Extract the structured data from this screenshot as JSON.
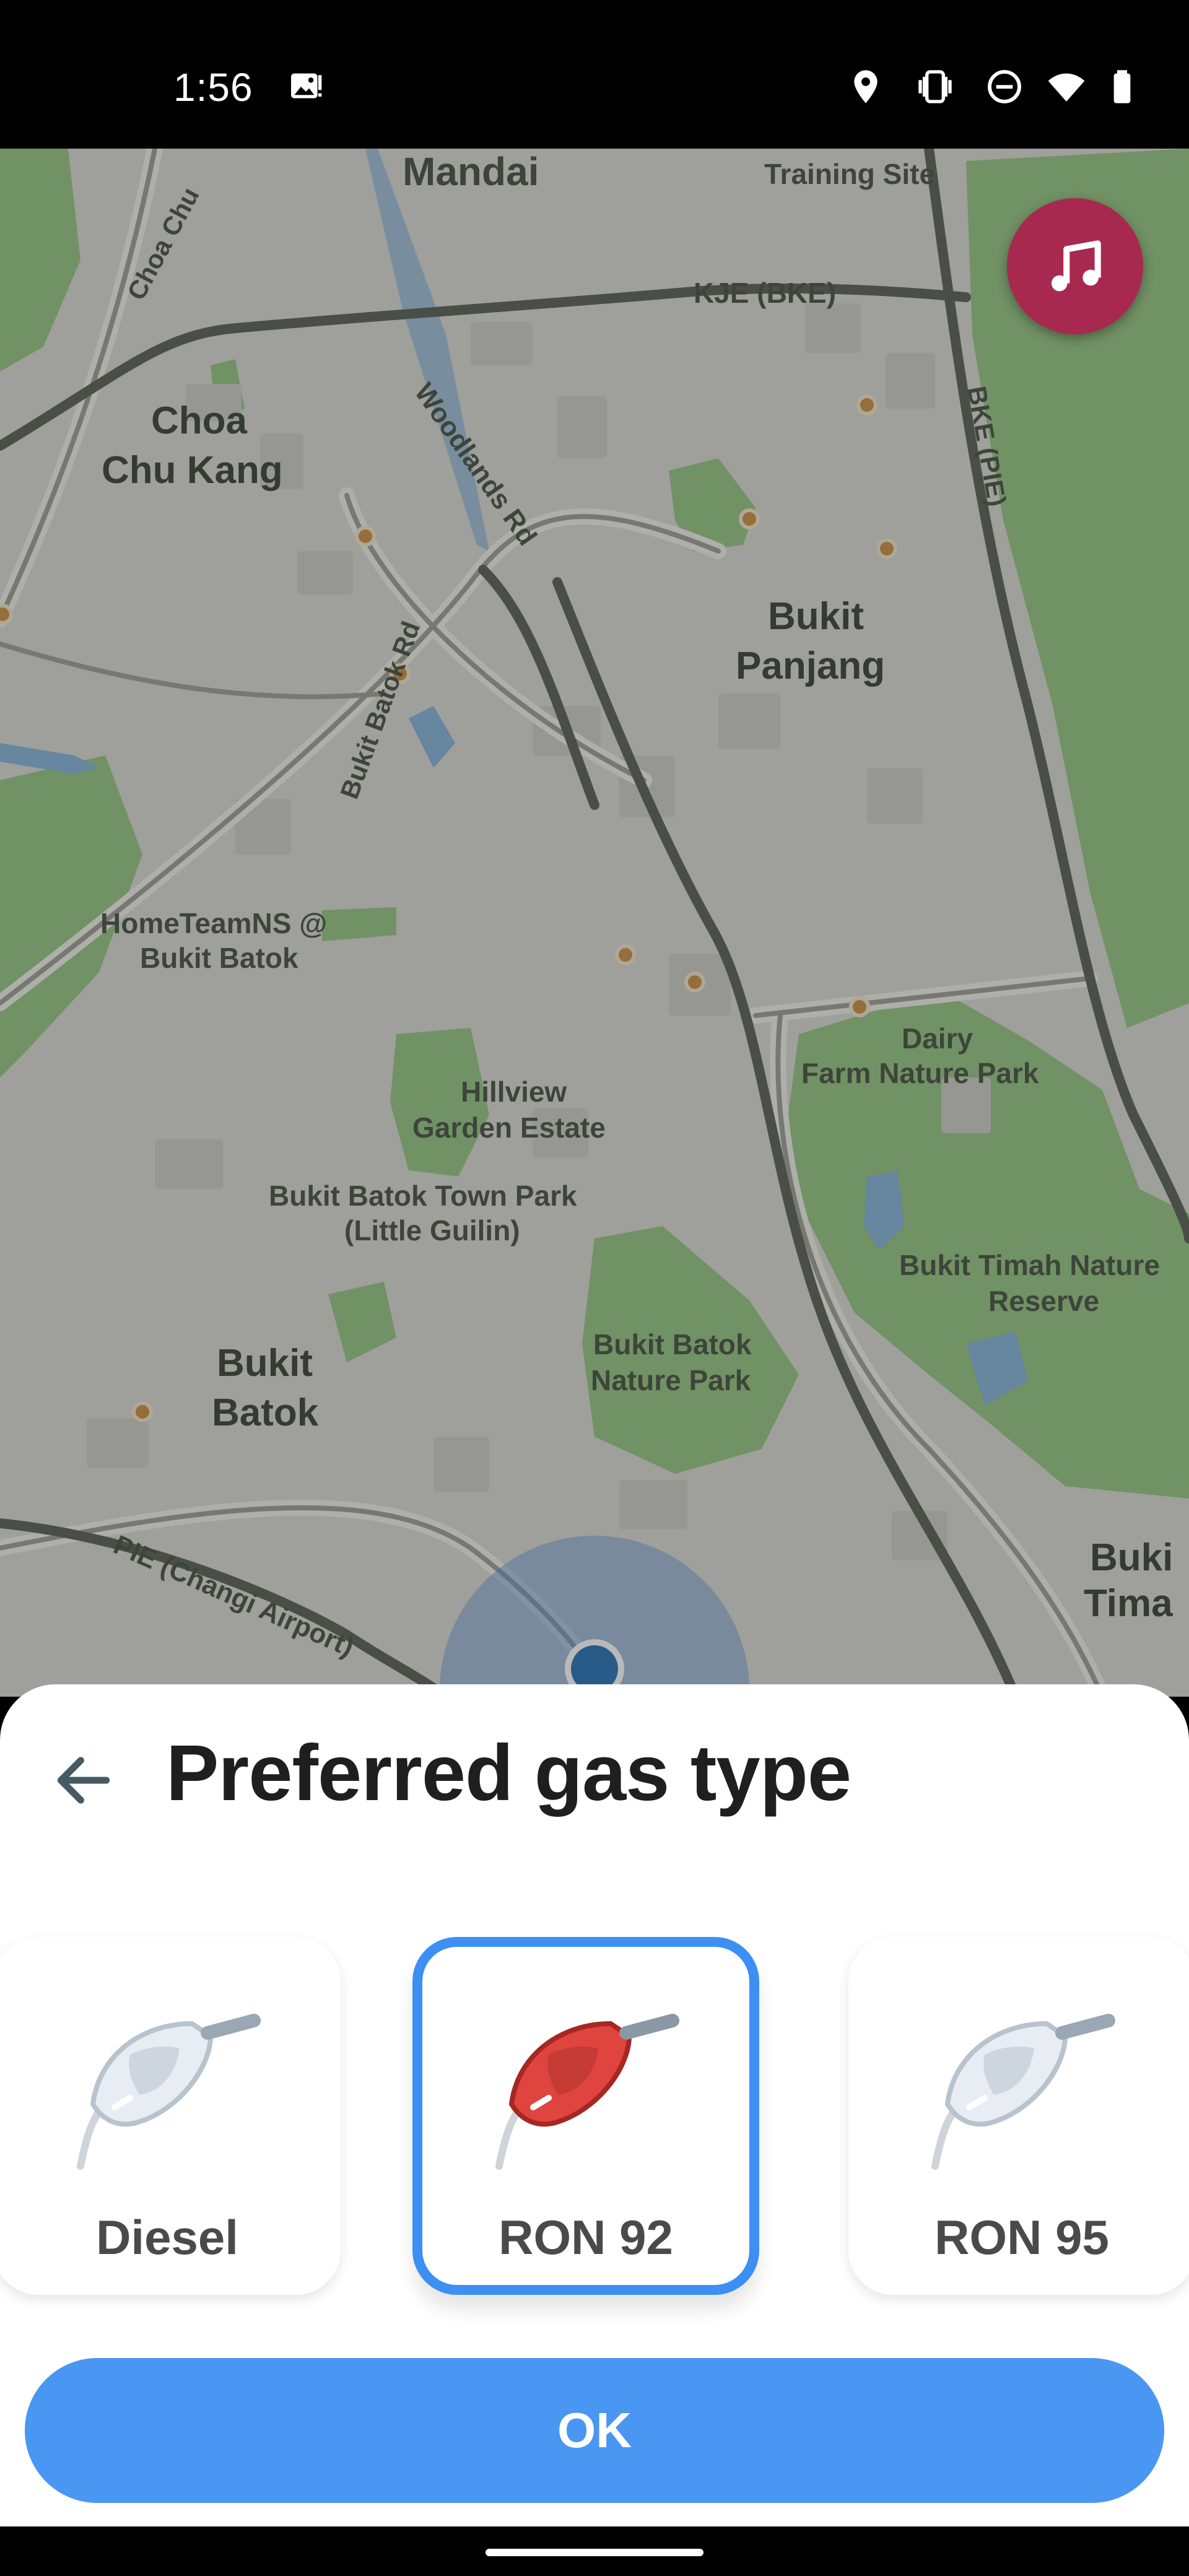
{
  "status_bar": {
    "time": "1:56",
    "icons": [
      "gallery-icon",
      "location-icon",
      "vibrate-icon",
      "do-not-disturb-icon",
      "wifi-icon",
      "battery-icon"
    ]
  },
  "map": {
    "labels": {
      "mandai": "Mandai",
      "training_site": "Training Site",
      "choa_chu": "Choa Chu",
      "kje": "KJE (BKE)",
      "woodlands_rd": "Woodlands Rd",
      "bke_pie": "BKE (PIE)",
      "choa_chu_kang_1": "Choa",
      "choa_chu_kang_2": "Chu Kang",
      "bukit_panjang_1": "Bukit",
      "bukit_panjang_2": "Panjang",
      "bukit_batok_rd": "Bukit Batok Rd",
      "hometeamns_1": "HomeTeamNS @",
      "hometeamns_2": "Bukit Batok",
      "dairy_farm_1": "Dairy",
      "dairy_farm_2": "Farm Nature Park",
      "hillview_1": "Hillview",
      "hillview_2": "Garden Estate",
      "town_park_1": "Bukit Batok Town Park",
      "town_park_2": "(Little Guilin)",
      "timah_reserve_1": "Bukit Timah Nature",
      "timah_reserve_2": "Reserve",
      "bukit_batok_1": "Bukit",
      "bukit_batok_2": "Batok",
      "batok_nature_1": "Bukit Batok",
      "batok_nature_2": "Nature Park",
      "pie": "PIE (Changi Airport)",
      "bukit_timah_1": "Buki",
      "bukit_timah_2": "Tima"
    },
    "music_button_icon": "music-note-icon",
    "colors": {
      "land": "#d7d7d2",
      "park": "#8fc27b",
      "road": "#6e6e66",
      "highway": "#505a4d",
      "water": "#7fb0d6",
      "poi": "#c88a3a",
      "music": "#a8294f",
      "location": "#1e6db5"
    }
  },
  "sheet": {
    "title": "Preferred gas type",
    "back_icon": "arrow-left-icon",
    "options": [
      {
        "label": "Diesel",
        "selected": false
      },
      {
        "label": "RON 92",
        "selected": true
      },
      {
        "label": "RON 95",
        "selected": false
      }
    ],
    "ok_label": "OK",
    "colors": {
      "accent": "#3c8ff3",
      "ok_button": "#4a96f3",
      "nozzle_selected": "#e0443e",
      "nozzle_unselected": "#e8edf3"
    }
  }
}
